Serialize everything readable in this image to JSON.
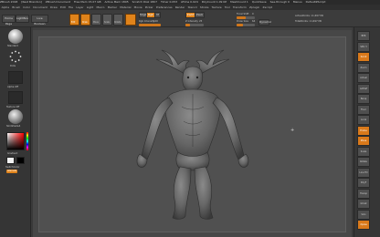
{
  "title_bar": {
    "app": "ZBrush 2018",
    "doc": "[Rest Brandon]",
    "items": [
      "ZBrush Document",
      "Free Mem 15.07 GB",
      "Active Mem 1805",
      "Scratch Disk 1807",
      "Timer 0.053",
      "ATime 0.024",
      "PolyCount 1.09 KP",
      "MeshCount 1",
      "QuickSave",
      "See-through 0",
      "Menus",
      "DefaultZScript"
    ]
  },
  "menu": {
    "items": [
      "Alpha",
      "Brush",
      "Color",
      "Document",
      "Draw",
      "Edit",
      "File",
      "Layer",
      "Light",
      "Macro",
      "Marker",
      "Material",
      "Movie",
      "Picker",
      "Preferences",
      "Render",
      "Stencil",
      "Stroke",
      "Texture",
      "Tool",
      "Transform",
      "Zplugin",
      "Zscript"
    ]
  },
  "toolbar": {
    "home_page": "Home Page",
    "lightbox": "LightBox",
    "live_boolean": "Live Boolean",
    "edit": "Edit",
    "draw": "Draw",
    "move": "Move",
    "scale": "Scale",
    "rotate": "Rotate",
    "mrgb": "Mrgb",
    "rgb": "Rgb",
    "m": "M",
    "zadd": "Zadd",
    "zsub": "Zsub",
    "rgb_intensity": "Rgb Intensity",
    "rgb_intensity_value": 100,
    "z_intensity": "Z Intensity",
    "z_intensity_value": 25,
    "focal_shift": "Focal Shift",
    "focal_shift_value": 0,
    "draw_size": "Draw Size",
    "draw_size_value": 64,
    "dynamic": "Dynamic",
    "active_points": "ActivePoints: 11,697 Mil",
    "total_points": "TotalPoints: 11,697 Mil"
  },
  "left_panel": {
    "standard": "Standard",
    "dots": "Dots",
    "alpha_off": "Alpha Off",
    "texture_off": "Texture Off",
    "material": "SkinShade4",
    "gradient": "Gradient",
    "switch_color": "SwitchColor",
    "alternate": "Alternate"
  },
  "right_panel": {
    "buttons": [
      "BPR",
      "SPix 3",
      "Scroll",
      "Zoom",
      "Actual",
      "AAHalf",
      "Persp",
      "Floor",
      "Local",
      "Frame",
      "Move",
      "Scale",
      "Rotate",
      "Line Fill",
      "PolyF",
      "Transp",
      "Ghost",
      "Solo",
      "Xpose"
    ]
  },
  "colors": {
    "accent": "#e0831a",
    "background": "#474747",
    "panel": "#353535"
  },
  "viewport": {
    "cursor_symbol": "+"
  }
}
